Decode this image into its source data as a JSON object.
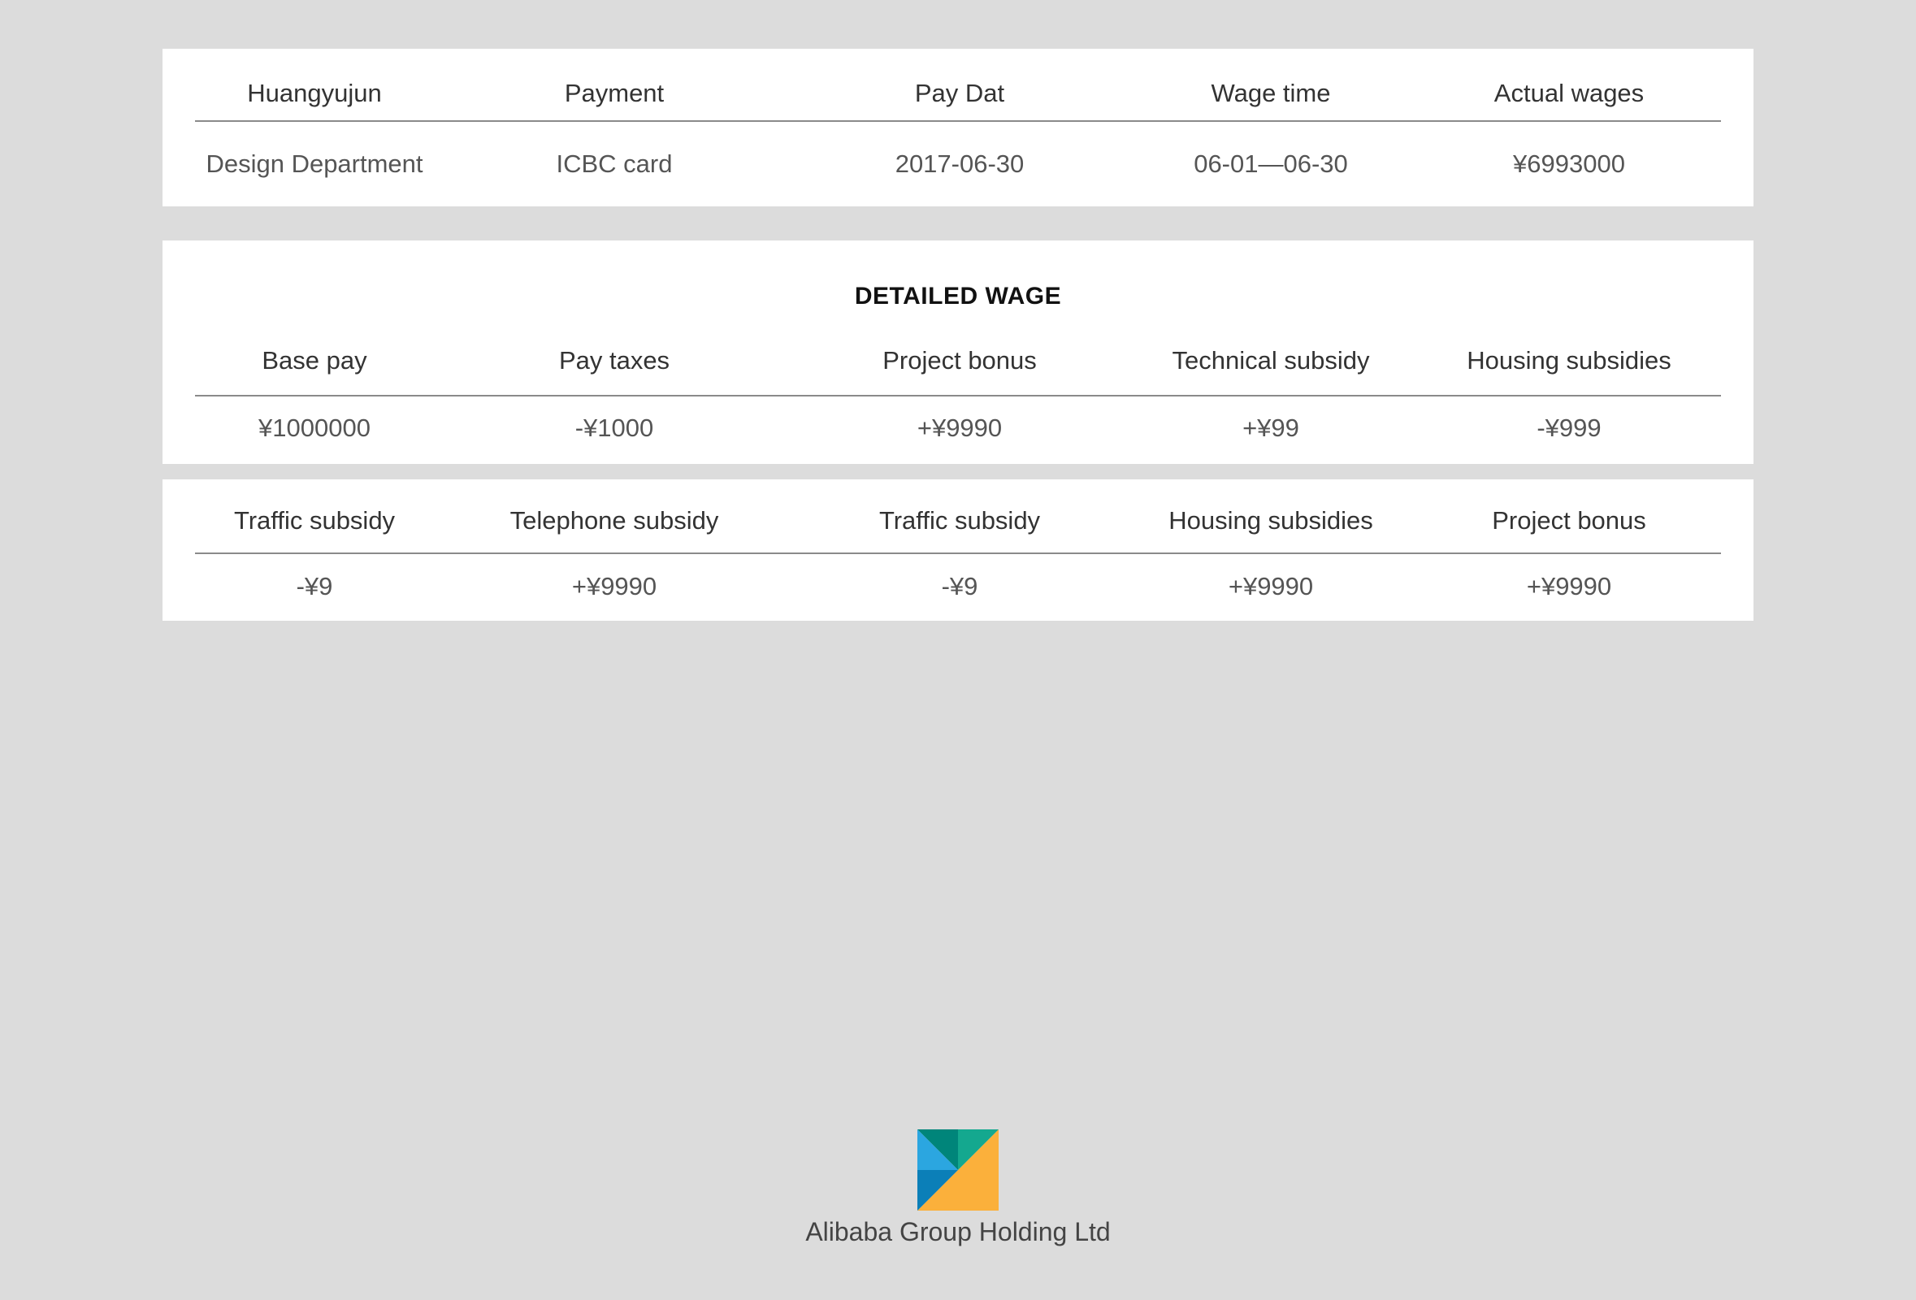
{
  "summary": {
    "headers": [
      "Huangyujun",
      "Payment",
      "Pay Dat",
      "Wage time",
      "Actual wages"
    ],
    "values": [
      "Design Department",
      "ICBC card",
      "2017-06-30",
      "06-01—06-30",
      "¥6993000"
    ]
  },
  "detailed": {
    "title": "DETAILED WAGE",
    "headers": [
      "Base pay",
      "Pay taxes",
      "Project bonus",
      "Technical subsidy",
      "Housing subsidies"
    ],
    "values": [
      "¥1000000",
      "-¥1000",
      "+¥9990",
      "+¥99",
      "-¥999"
    ]
  },
  "extra": {
    "headers": [
      "Traffic subsidy",
      "Telephone subsidy",
      "Traffic subsidy",
      "Housing subsidies",
      "Project bonus"
    ],
    "values": [
      "-¥9",
      "+¥9990",
      "-¥9",
      "+¥9990",
      "+¥9990"
    ]
  },
  "footer": {
    "company": "Alibaba Group Holding Ltd",
    "logo_icon": "alibaba-logo-icon",
    "logo_colors": {
      "dark_teal": "#00857a",
      "teal": "#14a88f",
      "light_blue": "#2ba6e0",
      "blue": "#0b7fb8",
      "orange": "#fbb03b"
    }
  },
  "colors": {
    "background": "#dcdcdc",
    "card": "#ffffff",
    "rule": "#8a8a8a",
    "text": "#333333"
  }
}
